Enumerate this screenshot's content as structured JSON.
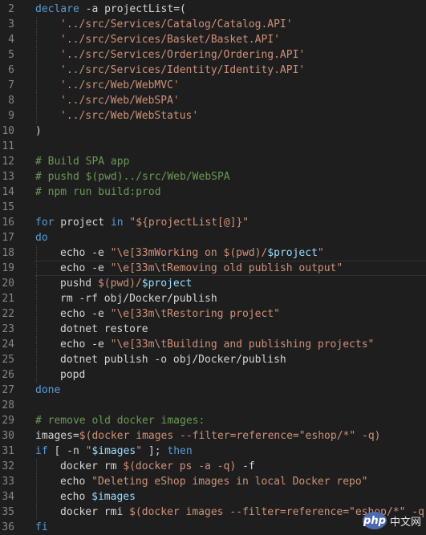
{
  "editor": {
    "language": "bash",
    "theme_colors": {
      "background": "#1e1e1e",
      "keyword": "#569cd6",
      "string": "#ce9178",
      "comment": "#6a9955",
      "variable": "#9cdcfe",
      "text": "#d4d4d4",
      "line_number": "#858585"
    },
    "current_line": 19,
    "lines": [
      {
        "n": "2",
        "indent": 0,
        "tokens": [
          [
            "kw",
            "declare"
          ],
          [
            "plain",
            " -a projectList=("
          ]
        ]
      },
      {
        "n": "3",
        "indent": 1,
        "tokens": [
          [
            "str",
            "'../src/Services/Catalog/Catalog.API'"
          ]
        ]
      },
      {
        "n": "4",
        "indent": 1,
        "tokens": [
          [
            "str",
            "'../src/Services/Basket/Basket.API'"
          ]
        ]
      },
      {
        "n": "5",
        "indent": 1,
        "tokens": [
          [
            "str",
            "'../src/Services/Ordering/Ordering.API'"
          ]
        ]
      },
      {
        "n": "6",
        "indent": 1,
        "tokens": [
          [
            "str",
            "'../src/Services/Identity/Identity.API'"
          ]
        ]
      },
      {
        "n": "7",
        "indent": 1,
        "tokens": [
          [
            "str",
            "'../src/Web/WebMVC'"
          ]
        ]
      },
      {
        "n": "8",
        "indent": 1,
        "tokens": [
          [
            "str",
            "'../src/Web/WebSPA'"
          ]
        ]
      },
      {
        "n": "9",
        "indent": 1,
        "tokens": [
          [
            "str",
            "'../src/Web/WebStatus'"
          ]
        ]
      },
      {
        "n": "10",
        "indent": 0,
        "tokens": [
          [
            "plain",
            ")"
          ]
        ]
      },
      {
        "n": "11",
        "indent": 0,
        "tokens": []
      },
      {
        "n": "12",
        "indent": 0,
        "tokens": [
          [
            "cmt",
            "# Build SPA app"
          ]
        ]
      },
      {
        "n": "13",
        "indent": 0,
        "tokens": [
          [
            "cmt",
            "# pushd $(pwd)../src/Web/WebSPA"
          ]
        ]
      },
      {
        "n": "14",
        "indent": 0,
        "tokens": [
          [
            "cmt",
            "# npm run build:prod"
          ]
        ]
      },
      {
        "n": "15",
        "indent": 0,
        "tokens": []
      },
      {
        "n": "16",
        "indent": 0,
        "tokens": [
          [
            "kw",
            "for"
          ],
          [
            "plain",
            " project "
          ],
          [
            "kw",
            "in"
          ],
          [
            "plain",
            " "
          ],
          [
            "str",
            "\"${projectList[@]}\""
          ]
        ]
      },
      {
        "n": "17",
        "indent": 0,
        "tokens": [
          [
            "kw",
            "do"
          ]
        ]
      },
      {
        "n": "18",
        "indent": 1,
        "tokens": [
          [
            "plain",
            "echo -e "
          ],
          [
            "str",
            "\"\\e[33mWorking on $(pwd)/"
          ],
          [
            "var",
            "$project"
          ],
          [
            "str",
            "\""
          ]
        ]
      },
      {
        "n": "19",
        "indent": 1,
        "tokens": [
          [
            "plain",
            "echo -e "
          ],
          [
            "str",
            "\"\\e[33m\\tRemoving old publish output\""
          ]
        ]
      },
      {
        "n": "20",
        "indent": 1,
        "tokens": [
          [
            "plain",
            "pushd "
          ],
          [
            "str",
            "$(pwd)/"
          ],
          [
            "var",
            "$project"
          ]
        ]
      },
      {
        "n": "21",
        "indent": 1,
        "tokens": [
          [
            "plain",
            "rm -rf obj/Docker/publish"
          ]
        ]
      },
      {
        "n": "22",
        "indent": 1,
        "tokens": [
          [
            "plain",
            "echo -e "
          ],
          [
            "str",
            "\"\\e[33m\\tRestoring project\""
          ]
        ]
      },
      {
        "n": "23",
        "indent": 1,
        "tokens": [
          [
            "plain",
            "dotnet restore"
          ]
        ]
      },
      {
        "n": "24",
        "indent": 1,
        "tokens": [
          [
            "plain",
            "echo -e "
          ],
          [
            "str",
            "\"\\e[33m\\tBuilding and publishing projects\""
          ]
        ]
      },
      {
        "n": "25",
        "indent": 1,
        "tokens": [
          [
            "plain",
            "dotnet publish -o obj/Docker/publish"
          ]
        ]
      },
      {
        "n": "26",
        "indent": 1,
        "tokens": [
          [
            "plain",
            "popd"
          ]
        ]
      },
      {
        "n": "27",
        "indent": 0,
        "tokens": [
          [
            "kw",
            "done"
          ]
        ]
      },
      {
        "n": "28",
        "indent": 0,
        "tokens": []
      },
      {
        "n": "29",
        "indent": 0,
        "tokens": [
          [
            "cmt",
            "# remove old docker images:"
          ]
        ]
      },
      {
        "n": "30",
        "indent": 0,
        "tokens": [
          [
            "plain",
            "images="
          ],
          [
            "str",
            "$(docker images --filter=reference=\"eshop/*\" -q)"
          ]
        ]
      },
      {
        "n": "31",
        "indent": 0,
        "tokens": [
          [
            "kw",
            "if"
          ],
          [
            "plain",
            " [ -n "
          ],
          [
            "str",
            "\""
          ],
          [
            "var",
            "$images"
          ],
          [
            "str",
            "\""
          ],
          [
            "plain",
            " ]; "
          ],
          [
            "kw",
            "then"
          ]
        ]
      },
      {
        "n": "32",
        "indent": 1,
        "tokens": [
          [
            "plain",
            "docker rm "
          ],
          [
            "str",
            "$(docker ps -a -q)"
          ],
          [
            "plain",
            " -f"
          ]
        ]
      },
      {
        "n": "33",
        "indent": 1,
        "tokens": [
          [
            "plain",
            "echo "
          ],
          [
            "str",
            "\"Deleting eShop images in local Docker repo\""
          ]
        ]
      },
      {
        "n": "34",
        "indent": 1,
        "tokens": [
          [
            "plain",
            "echo "
          ],
          [
            "var",
            "$images"
          ]
        ]
      },
      {
        "n": "35",
        "indent": 1,
        "tokens": [
          [
            "plain",
            "docker rmi "
          ],
          [
            "str",
            "$(docker images --filter=reference=\"eshop/*\" -q)"
          ]
        ]
      },
      {
        "n": "36",
        "indent": 0,
        "tokens": [
          [
            "kw",
            "fi"
          ]
        ]
      }
    ]
  },
  "watermark": {
    "logo_text": "php",
    "site_text": "中文网"
  }
}
